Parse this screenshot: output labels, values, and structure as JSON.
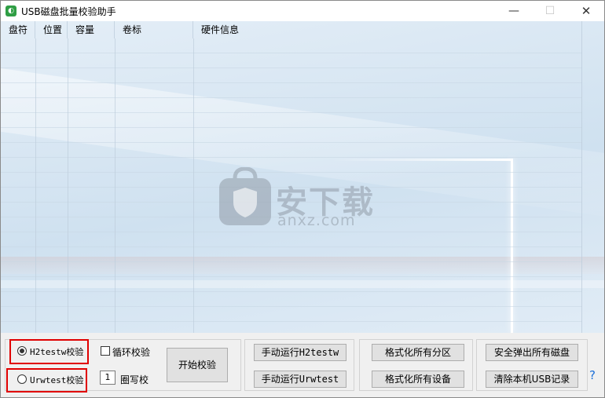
{
  "window": {
    "title": "USB磁盘批量校验助手",
    "app_icon": "app-shield-icon",
    "accent": "#2f9e44"
  },
  "titlebar": {
    "minimize": "—",
    "maximize": "☐",
    "close": "✕"
  },
  "table": {
    "columns": [
      "盘符",
      "位置",
      "容量",
      "卷标",
      "硬件信息"
    ],
    "rows": []
  },
  "watermark": {
    "text": "安下载",
    "sub": "anxz.com"
  },
  "controls": {
    "radio_h2testw": {
      "label": "H2testw校验",
      "selected": true
    },
    "radio_urwtest": {
      "label": "Urwtest校验",
      "selected": false
    },
    "loop_check": {
      "label": "循环校验",
      "checked": false
    },
    "rewrite_count": {
      "value": "1",
      "label": "圈写校"
    },
    "start_button": "开始校验",
    "manual_h2testw": "手动运行H2testw",
    "manual_urwtest": "手动运行Urwtest",
    "format_partitions": "格式化所有分区",
    "format_devices": "格式化所有设备",
    "eject_all": "安全弹出所有磁盘",
    "clear_usb": "清除本机USB记录",
    "help": "?"
  },
  "colors": {
    "highlight_box": "#e00000",
    "help_link": "#1b6fd8"
  }
}
